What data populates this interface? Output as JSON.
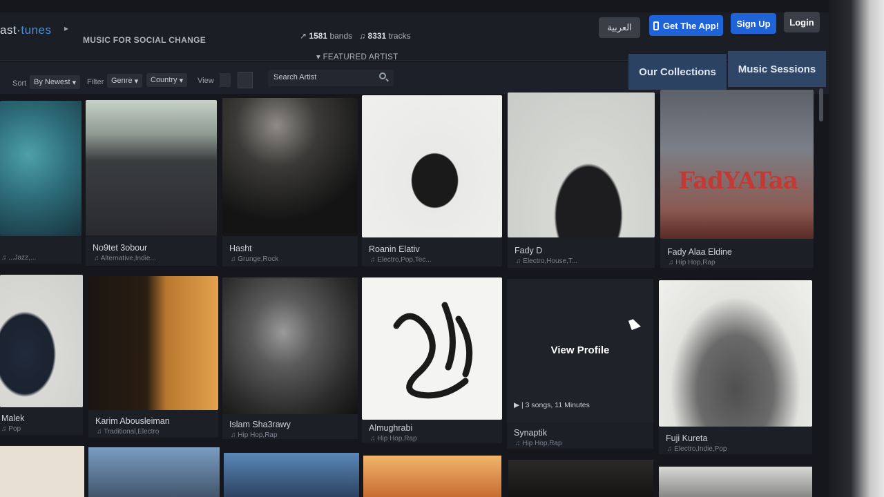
{
  "header": {
    "logo_prefix": "ast",
    "logo_dot": "·",
    "logo_suffix": "tunes",
    "tagline": "MUSIC FOR SOCIAL CHANGE",
    "bands_count": "1581",
    "bands_label": "bands",
    "tracks_count": "8331",
    "tracks_label": "tracks",
    "featured_label": "FEATURED ARTIST",
    "arabic_button": "العربية",
    "get_app_button": "Get The App!",
    "signup_button": "Sign Up",
    "login_button": "Login"
  },
  "filters": {
    "sort_label": "Sort",
    "sort_value": "By Newest",
    "filter_label": "Filter",
    "genre_value": "Genre",
    "country_value": "Country",
    "view_label": "View",
    "search_placeholder": "Search Artist"
  },
  "tabs": {
    "collections": "Our Collections",
    "sessions": "Music Sessions"
  },
  "artists": [
    {
      "name": "",
      "genre": "...Jazz,..."
    },
    {
      "name": "No9tet 3obour",
      "genre": "Alternative,Indie..."
    },
    {
      "name": "Hasht",
      "genre": "Grunge,Rock"
    },
    {
      "name": "Roanin Elativ",
      "genre": "Electro,Pop,Tec..."
    },
    {
      "name": "Fady D",
      "genre": "Electro,House,T..."
    },
    {
      "name": "Fady Alaa Eldine",
      "genre": "Hip Hop,Rap"
    },
    {
      "name": "Malek",
      "genre": "Pop"
    },
    {
      "name": "Karim Abousleiman",
      "genre": "Traditional,Electro"
    },
    {
      "name": "Islam Sha3rawy",
      "genre": "Hip Hop,Rap"
    },
    {
      "name": "Almughrabi",
      "genre": "Hip Hop,Rap"
    },
    {
      "name": "Synaptik",
      "genre": "Hip Hop,Rap"
    },
    {
      "name": "Fuji Kureta",
      "genre": "Electro,Indie,Pop"
    }
  ],
  "hover_card": {
    "view_profile": "View Profile",
    "songs_info": "| 3 songs, 11 Minutes"
  },
  "artwork": {
    "fady_ataa_logo_text": "FadYATaa"
  }
}
